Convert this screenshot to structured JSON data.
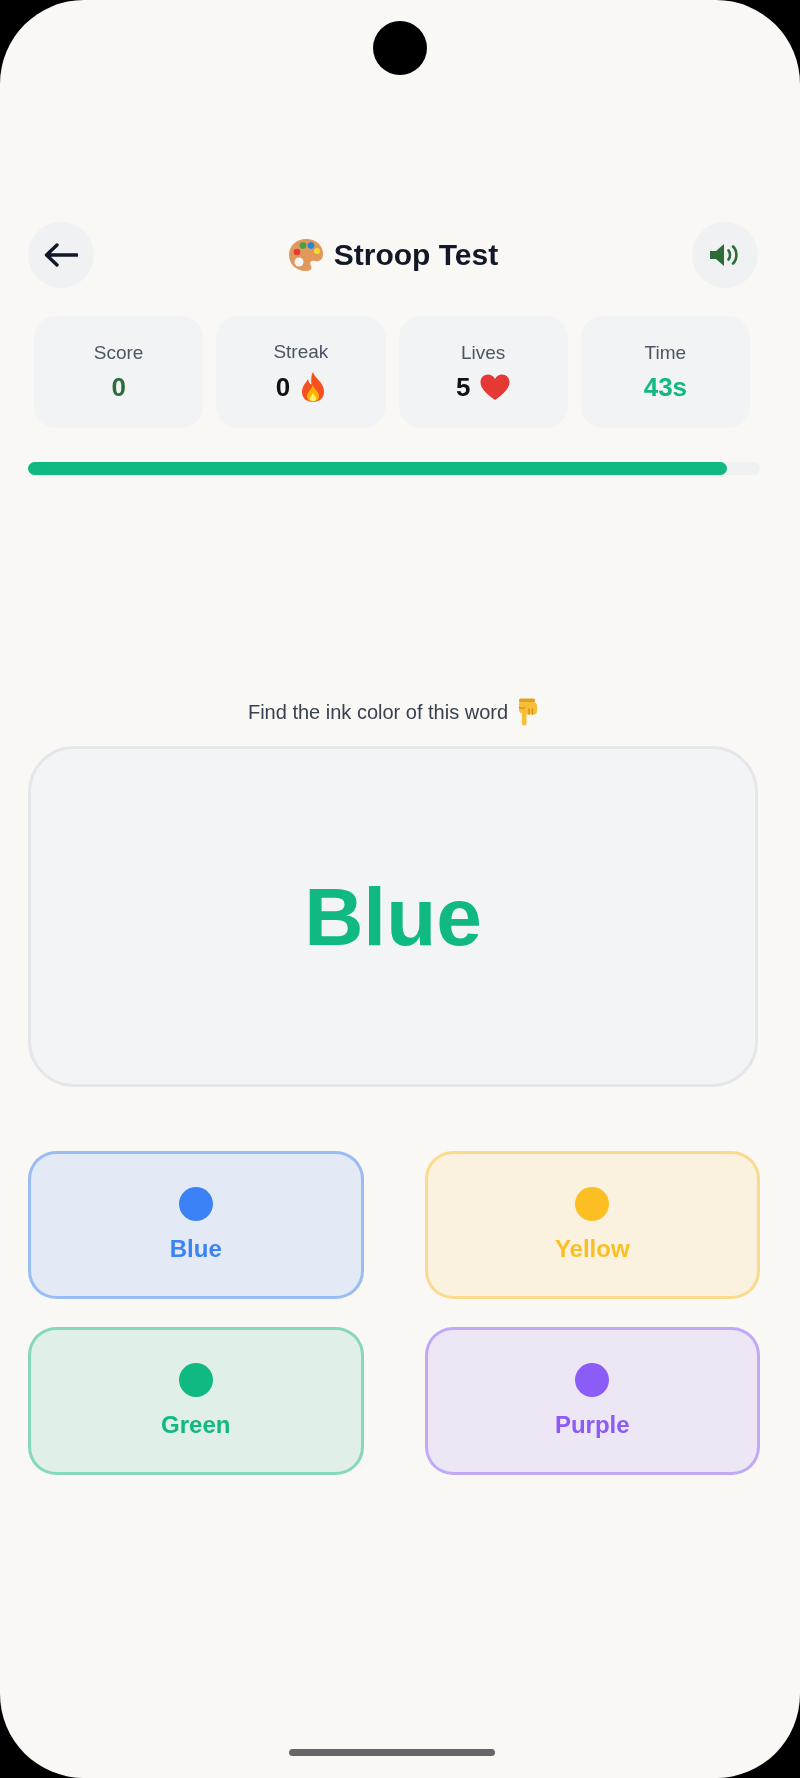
{
  "header": {
    "title": "Stroop Test"
  },
  "stats": [
    {
      "kind": "score",
      "label": "Score",
      "value": "0"
    },
    {
      "kind": "streak",
      "label": "Streak",
      "value": "0"
    },
    {
      "kind": "lives",
      "label": "Lives",
      "value": "5"
    },
    {
      "kind": "time",
      "label": "Time",
      "value": "43s"
    }
  ],
  "progress": {
    "level": 0.955
  },
  "prompt": "Find the ink color of this word",
  "stimulus": {
    "word": "Blue",
    "color": "#10b981"
  },
  "options": [
    {
      "label": "Blue",
      "color": "#3b82f6"
    },
    {
      "label": "Yellow",
      "color": "#fbbf24"
    },
    {
      "label": "Green",
      "color": "#10b981"
    },
    {
      "label": "Purple",
      "color": "#8b5cf6"
    }
  ]
}
